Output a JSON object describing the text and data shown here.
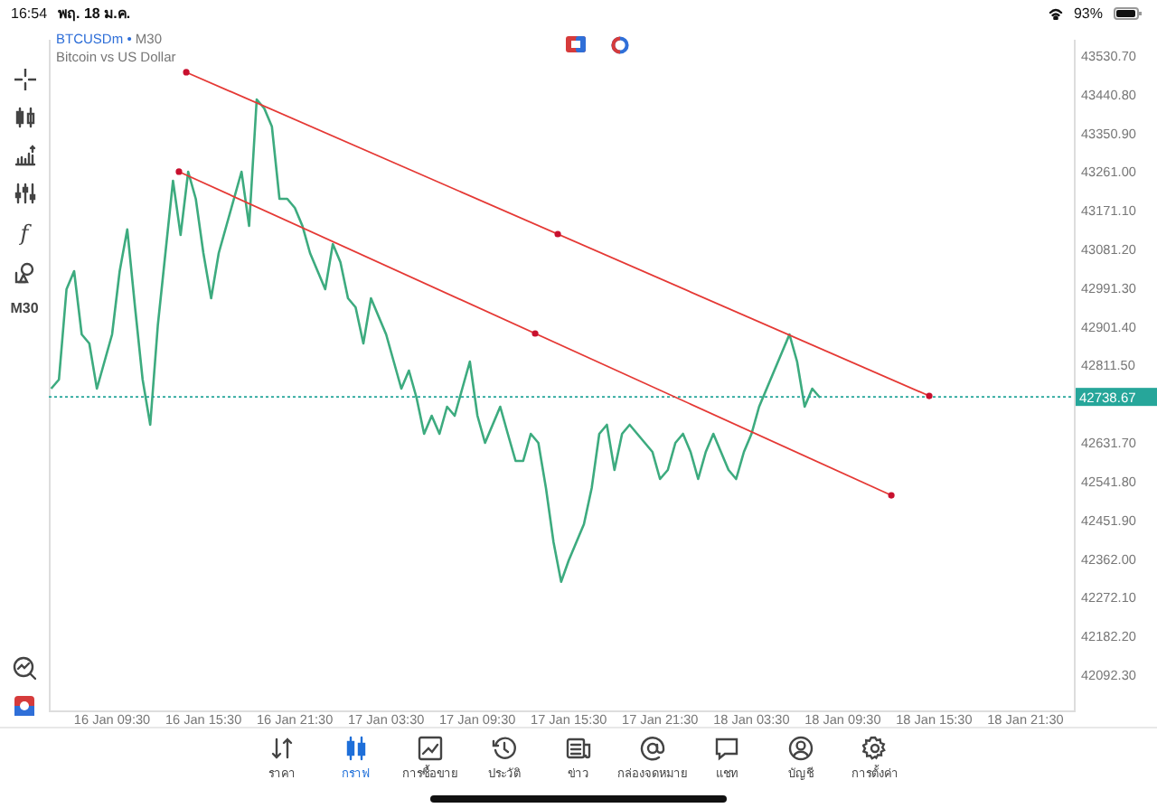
{
  "status_bar": {
    "time": "16:54",
    "date": "พฤ. 18 ม.ค.",
    "battery": "93%"
  },
  "toolbar": {
    "function_symbol": "f",
    "timeframe": "M30"
  },
  "chart": {
    "symbol": "BTCUSDm",
    "separator": "•",
    "timeframe": "M30",
    "description": "Bitcoin vs US Dollar",
    "chart_data": {
      "type": "line",
      "ref_lines": [
        {
          "axis": "y",
          "value": 42738.67,
          "label": "42738.67"
        }
      ],
      "categories": [
        null,
        null,
        null,
        null,
        null,
        null,
        null,
        null,
        "16 Jan 09:30",
        null,
        null,
        null,
        null,
        null,
        null,
        null,
        null,
        null,
        null,
        null,
        "16 Jan 15:30",
        null,
        null,
        null,
        null,
        null,
        null,
        null,
        null,
        null,
        null,
        null,
        "16 Jan 21:30",
        null,
        null,
        null,
        null,
        null,
        null,
        null,
        null,
        null,
        null,
        null,
        "17 Jan 03:30",
        null,
        null,
        null,
        null,
        null,
        null,
        null,
        null,
        null,
        null,
        null,
        "17 Jan 09:30",
        null,
        null,
        null,
        null,
        null,
        null,
        null,
        null,
        null,
        null,
        null,
        "17 Jan 15:30",
        null,
        null,
        null,
        null,
        null,
        null,
        null,
        null,
        null,
        null,
        null,
        "17 Jan 21:30",
        null,
        null,
        null,
        null,
        null,
        null,
        null,
        null,
        null,
        null,
        null,
        "18 Jan 03:30",
        null,
        null,
        null,
        null,
        null,
        null,
        null,
        null,
        null,
        null,
        null,
        "18 Jan 09:30",
        null,
        null,
        null,
        null,
        null,
        null,
        null,
        null,
        null,
        null,
        null,
        "18 Jan 15:30",
        null,
        null,
        null,
        null,
        null,
        null,
        null,
        null,
        null,
        null,
        null,
        "18 Jan 21:30",
        null,
        null,
        null,
        null,
        null,
        null
      ],
      "series": [
        {
          "color": "#3dab7f",
          "values": [
            42758,
            42779,
            42989,
            43031,
            42884,
            42863,
            42758,
            42821,
            42884,
            43031,
            43128,
            42947,
            42779,
            42674,
            42905,
            43073,
            43241,
            43115,
            43262,
            43199,
            43073,
            42968,
            43073,
            43136,
            43199,
            43262,
            43136,
            43430,
            43409,
            43367,
            43199,
            43199,
            43178,
            43136,
            43073,
            43031,
            42989,
            43094,
            43052,
            42968,
            42947,
            42863,
            42968,
            42926,
            42884,
            42821,
            42758,
            42800,
            42737,
            42653,
            42695,
            42653,
            42716,
            42695,
            42758,
            42821,
            42695,
            42632,
            42674,
            42716,
            42653,
            42590,
            42590,
            42653,
            42632,
            42527,
            42401,
            42309,
            42359,
            42401,
            42443,
            42527,
            42653,
            42674,
            42569,
            42653,
            42674,
            42653,
            42632,
            42611,
            42548,
            42569,
            42632,
            42653,
            42611,
            42548,
            42611,
            42653,
            42611,
            42569,
            42548,
            42611,
            42653,
            42716,
            42758,
            42800,
            42842,
            42884,
            42821,
            42716,
            42758,
            42737,
            null,
            null,
            null,
            null,
            null,
            null,
            null,
            null,
            null,
            null,
            null,
            null,
            null,
            null,
            null,
            null,
            null,
            null,
            null,
            null,
            null,
            null,
            null,
            null,
            null,
            null,
            null,
            null,
            null,
            null,
            null,
            null,
            null
          ]
        }
      ],
      "ylim": [
        42010.3,
        43568.5
      ],
      "yticks": [
        {
          "value": 43530.7,
          "label": "43530.70"
        },
        {
          "value": 43440.8,
          "label": "43440.80"
        },
        {
          "value": 43350.9,
          "label": "43350.90"
        },
        {
          "value": 43261.0,
          "label": "43261.00"
        },
        {
          "value": 43171.1,
          "label": "43171.10"
        },
        {
          "value": 43081.2,
          "label": "43081.20"
        },
        {
          "value": 42991.3,
          "label": "42991.30"
        },
        {
          "value": 42901.4,
          "label": "42901.40"
        },
        {
          "value": 42811.5,
          "label": "42811.50"
        },
        {
          "value": 42631.7,
          "label": "42631.70"
        },
        {
          "value": 42541.8,
          "label": "42541.80"
        },
        {
          "value": 42451.9,
          "label": "42451.90"
        },
        {
          "value": 42362.0,
          "label": "42362.00"
        },
        {
          "value": 42272.1,
          "label": "42272.10"
        },
        {
          "value": 42182.2,
          "label": "42182.20"
        },
        {
          "value": 42092.3,
          "label": "42092.30"
        }
      ]
    }
  },
  "tabs": [
    {
      "label": "ราคา",
      "selected": false
    },
    {
      "label": "กราฟ",
      "selected": true
    },
    {
      "label": "การซื้อขาย",
      "selected": false
    },
    {
      "label": "ประวัติ",
      "selected": false
    },
    {
      "label": "ข่าว",
      "selected": false
    },
    {
      "label": "กล่องจดหมาย",
      "selected": false
    },
    {
      "label": "แชท",
      "selected": false
    },
    {
      "label": "บัญชี",
      "selected": false
    },
    {
      "label": "การตั้งค่า",
      "selected": false
    }
  ]
}
